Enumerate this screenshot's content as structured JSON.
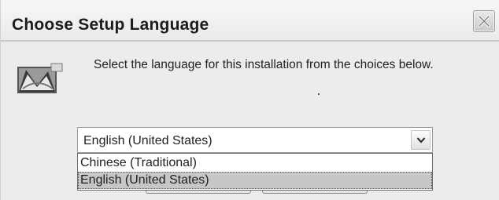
{
  "dialog": {
    "title": "Choose Setup Language",
    "message": "Select the language for this installation from the choices below.",
    "close_icon": "close-icon",
    "setup_icon": "setup-wizard-icon"
  },
  "language_select": {
    "selected": "English (United States)",
    "dropdown_icon": "chevron-down-icon",
    "options": [
      "Chinese (Traditional)",
      "English (United States)"
    ],
    "highlighted_option": "English (United States)"
  }
}
